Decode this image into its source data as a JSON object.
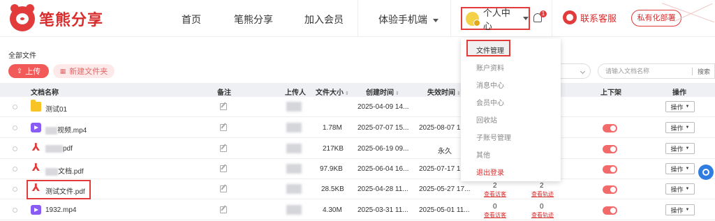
{
  "header": {
    "logo_text": "笔熊分享",
    "nav": {
      "home": "首页",
      "share": "笔熊分享",
      "join": "加入会员",
      "mobile": "体验手机端"
    },
    "user_center": "个人中心",
    "notification_count": "1",
    "support": "联系客服",
    "private_deploy": "私有化部署"
  },
  "toolbar": {
    "breadcrumb": "全部文件",
    "upload": "上传",
    "new_folder": "新建文件夹",
    "search_placeholder": "请输入文档名称",
    "search_btn": "搜索"
  },
  "table": {
    "headers": {
      "name": "文档名称",
      "note": "备注",
      "uploader": "上传人",
      "size": "文件大小",
      "created": "创建时间",
      "expire": "失效时间",
      "shelf": "上下架",
      "action": "操作"
    },
    "action_label": "操作",
    "view_visits": "查看访客",
    "view_track": "查看轨迹",
    "rows": [
      {
        "name": "测试01",
        "size": "",
        "created": "2025-04-09 14...",
        "expire": ""
      },
      {
        "name": "视频.mp4",
        "size": "1.78M",
        "created": "2025-07-07 15...",
        "expire": "2025-08-07 1"
      },
      {
        "name": "pdf",
        "size": "217KB",
        "created": "2025-06-19 09...",
        "expire": "永久"
      },
      {
        "name": "文档.pdf",
        "size": "97.9KB",
        "created": "2025-06-04 16...",
        "expire": "2025-07-17 1"
      },
      {
        "name": "测试文件.pdf",
        "size": "28.5KB",
        "created": "2025-04-28 11...",
        "expire": "2025-05-27 17...",
        "visits": "2",
        "track": "2"
      },
      {
        "name": "1932.mp4",
        "size": "4.30M",
        "created": "2025-03-31 11...",
        "expire": "2025-05-01 11...",
        "visits": "0",
        "track": "0"
      }
    ]
  },
  "dropdown": {
    "items": [
      "文件管理",
      "账户资料",
      "消息中心",
      "会员中心",
      "回收站",
      "子账号管理",
      "其他",
      "退出登录"
    ]
  },
  "colors": {
    "brand": "#e23b3b",
    "header_bg": "#eef0f3"
  }
}
